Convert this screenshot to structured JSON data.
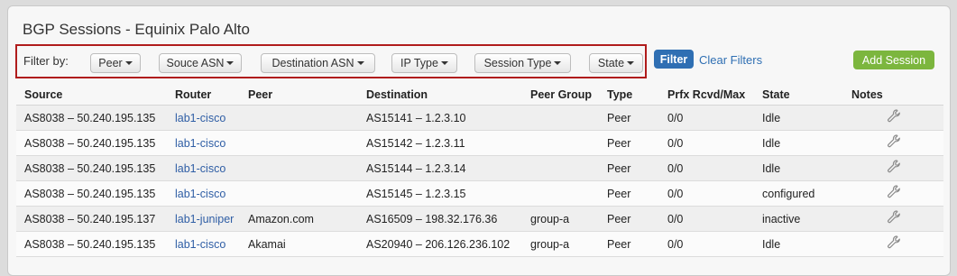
{
  "page": {
    "title": "BGP Sessions - Equinix Palo Alto"
  },
  "filters": {
    "label": "Filter by:",
    "dropdowns": [
      "Peer",
      "Souce ASN",
      "Destination ASN",
      "IP Type",
      "Session Type",
      "State"
    ],
    "filter_button": "Filter",
    "clear_filters": "Clear Filters"
  },
  "actions": {
    "add_session": "Add Session"
  },
  "table": {
    "columns": [
      "Source",
      "Router",
      "Peer",
      "Destination",
      "Peer Group",
      "Type",
      "Prfx Rcvd/Max",
      "State",
      "Notes"
    ],
    "rows": [
      {
        "source": "AS8038 – 50.240.195.135",
        "router": "lab1-cisco",
        "peer": "",
        "destination": "AS15141 – 1.2.3.10",
        "peer_group": "",
        "type": "Peer",
        "prefixes": "0/0",
        "state": "Idle"
      },
      {
        "source": "AS8038 – 50.240.195.135",
        "router": "lab1-cisco",
        "peer": "",
        "destination": "AS15142 – 1.2.3.11",
        "peer_group": "",
        "type": "Peer",
        "prefixes": "0/0",
        "state": "Idle"
      },
      {
        "source": "AS8038 – 50.240.195.135",
        "router": "lab1-cisco",
        "peer": "",
        "destination": "AS15144 – 1.2.3.14",
        "peer_group": "",
        "type": "Peer",
        "prefixes": "0/0",
        "state": "Idle"
      },
      {
        "source": "AS8038 – 50.240.195.135",
        "router": "lab1-cisco",
        "peer": "",
        "destination": "AS15145 – 1.2.3.15",
        "peer_group": "",
        "type": "Peer",
        "prefixes": "0/0",
        "state": "configured"
      },
      {
        "source": "AS8038 – 50.240.195.137",
        "router": "lab1-juniper",
        "peer": "Amazon.com",
        "destination": "AS16509 – 198.32.176.36",
        "peer_group": "group-a",
        "type": "Peer",
        "prefixes": "0/0",
        "state": "inactive"
      },
      {
        "source": "AS8038 – 50.240.195.135",
        "router": "lab1-cisco",
        "peer": "Akamai",
        "destination": "AS20940 – 206.126.236.102",
        "peer_group": "group-a",
        "type": "Peer",
        "prefixes": "0/0",
        "state": "Idle"
      }
    ],
    "notes_icon": "wrench-icon"
  },
  "colors": {
    "highlight_border": "#b01c1c",
    "filter_button": "#2f6fb3",
    "add_button": "#7cb63e",
    "link": "#2f5ea5"
  }
}
